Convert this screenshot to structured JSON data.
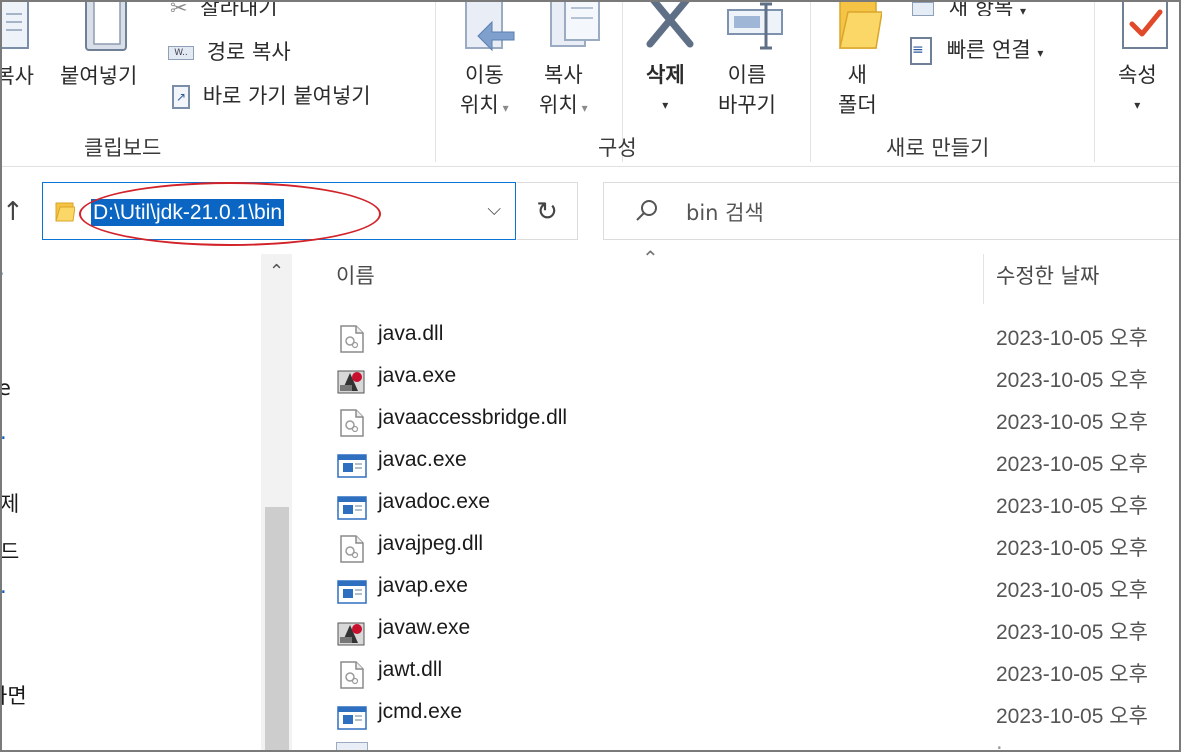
{
  "ribbon": {
    "clipboard": {
      "paste_label": "붙여넣기",
      "copy_label_partial": "복사",
      "cut_label_partial": "잘라내기",
      "copy_path_label": "경로 복사",
      "paste_shortcut_label": "바로 가기 붙여넣기",
      "group_label": "클립보드"
    },
    "organize": {
      "move_to_line1": "이동",
      "move_to_line2": "위치",
      "copy_to_line1": "복사",
      "copy_to_line2": "위치",
      "delete_label": "삭제",
      "rename_line1": "이름",
      "rename_line2": "바꾸기",
      "group_label": "구성"
    },
    "new": {
      "new_item_label_partial": "새 항목",
      "easy_access_label": "빠른 연결",
      "new_folder_line1": "새",
      "new_folder_line2": "폴더",
      "group_label": "새로 만들기"
    },
    "open": {
      "properties_label": "속성"
    }
  },
  "address_bar": {
    "path": "D:\\Util\\jdk-21.0.1\\bin"
  },
  "search": {
    "placeholder": "bin 검색"
  },
  "nav_pane": {
    "items": [
      "e",
      "제",
      "드",
      "화면"
    ]
  },
  "file_list": {
    "columns": {
      "name": "이름",
      "date_modified": "수정한 날짜"
    },
    "files": [
      {
        "name": "java.dll",
        "icon": "dll-file-icon",
        "date": "2023-10-05 오후"
      },
      {
        "name": "java.exe",
        "icon": "java-exe-icon",
        "date": "2023-10-05 오후"
      },
      {
        "name": "javaaccessbridge.dll",
        "icon": "dll-file-icon",
        "date": "2023-10-05 오후"
      },
      {
        "name": "javac.exe",
        "icon": "exe-window-icon",
        "date": "2023-10-05 오후"
      },
      {
        "name": "javadoc.exe",
        "icon": "exe-window-icon",
        "date": "2023-10-05 오후"
      },
      {
        "name": "javajpeg.dll",
        "icon": "dll-file-icon",
        "date": "2023-10-05 오후"
      },
      {
        "name": "javap.exe",
        "icon": "exe-window-icon",
        "date": "2023-10-05 오후"
      },
      {
        "name": "javaw.exe",
        "icon": "java-exe-icon",
        "date": "2023-10-05 오후"
      },
      {
        "name": "jawt.dll",
        "icon": "dll-file-icon",
        "date": "2023-10-05 오후"
      },
      {
        "name": "jcmd.exe",
        "icon": "exe-window-icon",
        "date": "2023-10-05 오후"
      }
    ]
  },
  "colors": {
    "accent": "#0a66c2",
    "highlight_circle": "#d2232a",
    "folder": "#f6c445"
  }
}
